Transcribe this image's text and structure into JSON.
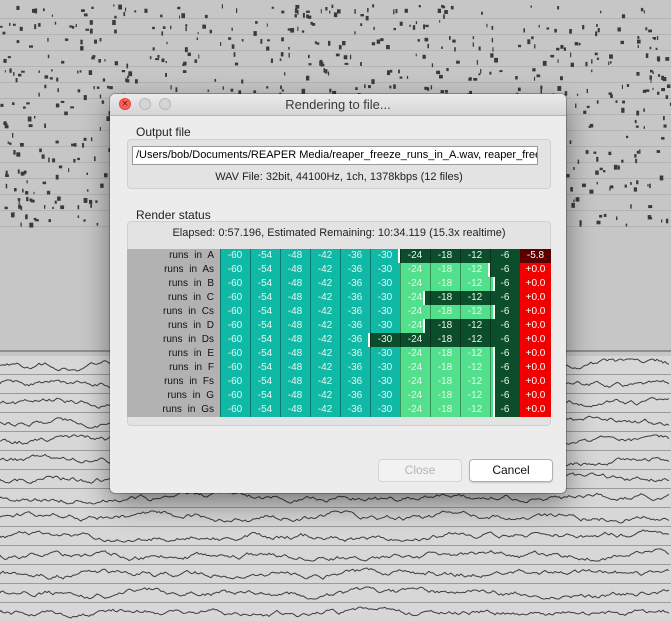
{
  "dialog": {
    "title": "Rendering to file...",
    "output_section_label": "Output file",
    "output_path": "/Users/bob/Documents/REAPER Media/reaper_freeze_runs_in_A.wav, reaper_freeze_",
    "format_info": "WAV File: 32bit, 44100Hz, 1ch, 1378kbps (12 files)",
    "status_section_label": "Render status",
    "progress_text": "Elapsed: 0:57.196, Estimated Remaining: 10:34.119 (15.3x realtime)",
    "close_label": "Close",
    "cancel_label": "Cancel"
  },
  "meter_scale": [
    "-60",
    "-54",
    "-48",
    "-42",
    "-36",
    "-30",
    "-24",
    "-18",
    "-12",
    "-6"
  ],
  "meter_range_db": [
    -60,
    0
  ],
  "colors": {
    "close_button": "#ff5f57",
    "peak_clip": "#f20000",
    "peak_normal": "#5a0000",
    "meter_teal": "#10b9a6",
    "meter_green": "#52e08c"
  },
  "meters": [
    {
      "label": "runs  in  A",
      "peak": "-5.8",
      "level_db": -24,
      "clip": false
    },
    {
      "label": "runs  in  As",
      "peak": "+0.0",
      "level_db": -6,
      "clip": true
    },
    {
      "label": "runs  in  B",
      "peak": "+0.0",
      "level_db": -5,
      "clip": true
    },
    {
      "label": "runs  in  C",
      "peak": "+0.0",
      "level_db": -19,
      "clip": true
    },
    {
      "label": "runs  in  Cs",
      "peak": "+0.0",
      "level_db": -5,
      "clip": true
    },
    {
      "label": "runs  in  D",
      "peak": "+0.0",
      "level_db": -19,
      "clip": true
    },
    {
      "label": "runs  in  Ds",
      "peak": "+0.0",
      "level_db": -30,
      "clip": true
    },
    {
      "label": "runs  in  E",
      "peak": "+0.0",
      "level_db": -5,
      "clip": true
    },
    {
      "label": "runs  in  F",
      "peak": "+0.0",
      "level_db": -5,
      "clip": true
    },
    {
      "label": "runs  in  Fs",
      "peak": "+0.0",
      "level_db": -5,
      "clip": true
    },
    {
      "label": "runs  in  G",
      "peak": "+0.0",
      "level_db": -5,
      "clip": true
    },
    {
      "label": "runs  in  Gs",
      "peak": "+0.0",
      "level_db": -5,
      "clip": true
    }
  ]
}
